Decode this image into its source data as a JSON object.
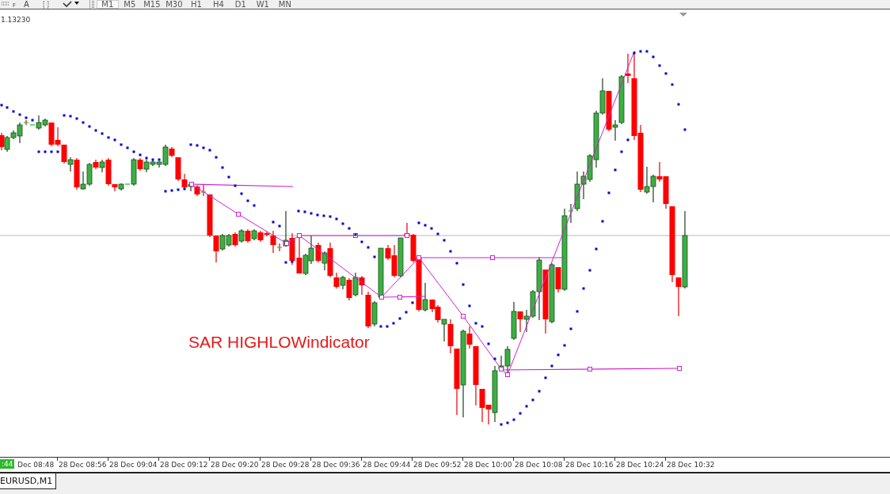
{
  "toolbar": {
    "tools": [
      {
        "kind": "fibo",
        "label": "F"
      },
      {
        "kind": "text",
        "label": "A"
      },
      {
        "kind": "label"
      },
      {
        "kind": "arrow"
      }
    ],
    "timeframes": [
      {
        "label": "M1",
        "selected": true
      },
      {
        "label": "M5",
        "selected": false
      },
      {
        "label": "M15",
        "selected": false
      },
      {
        "label": "M30",
        "selected": false
      },
      {
        "label": "H1",
        "selected": false
      },
      {
        "label": "H4",
        "selected": false
      },
      {
        "label": "D1",
        "selected": false
      },
      {
        "label": "W1",
        "selected": false
      },
      {
        "label": "MN",
        "selected": false
      }
    ]
  },
  "chart": {
    "price_label": "1.13230",
    "caption": "SAR HIGHLOWindicator"
  },
  "time_axis": {
    "current_label": ":44",
    "labels": [
      "Dec 08:48",
      "28 Dec 08:56",
      "28 Dec 09:04",
      "28 Dec 09:12",
      "28 Dec 09:20",
      "28 Dec 09:28",
      "28 Dec 09:36",
      "28 Dec 09:44",
      "28 Dec 09:52",
      "28 Dec 10:00",
      "28 Dec 10:08",
      "28 Dec 10:16",
      "28 Dec 10:24",
      "28 Dec 10:32"
    ]
  },
  "tabs": [
    {
      "label": "EURUSD,M1",
      "selected": true
    }
  ]
}
